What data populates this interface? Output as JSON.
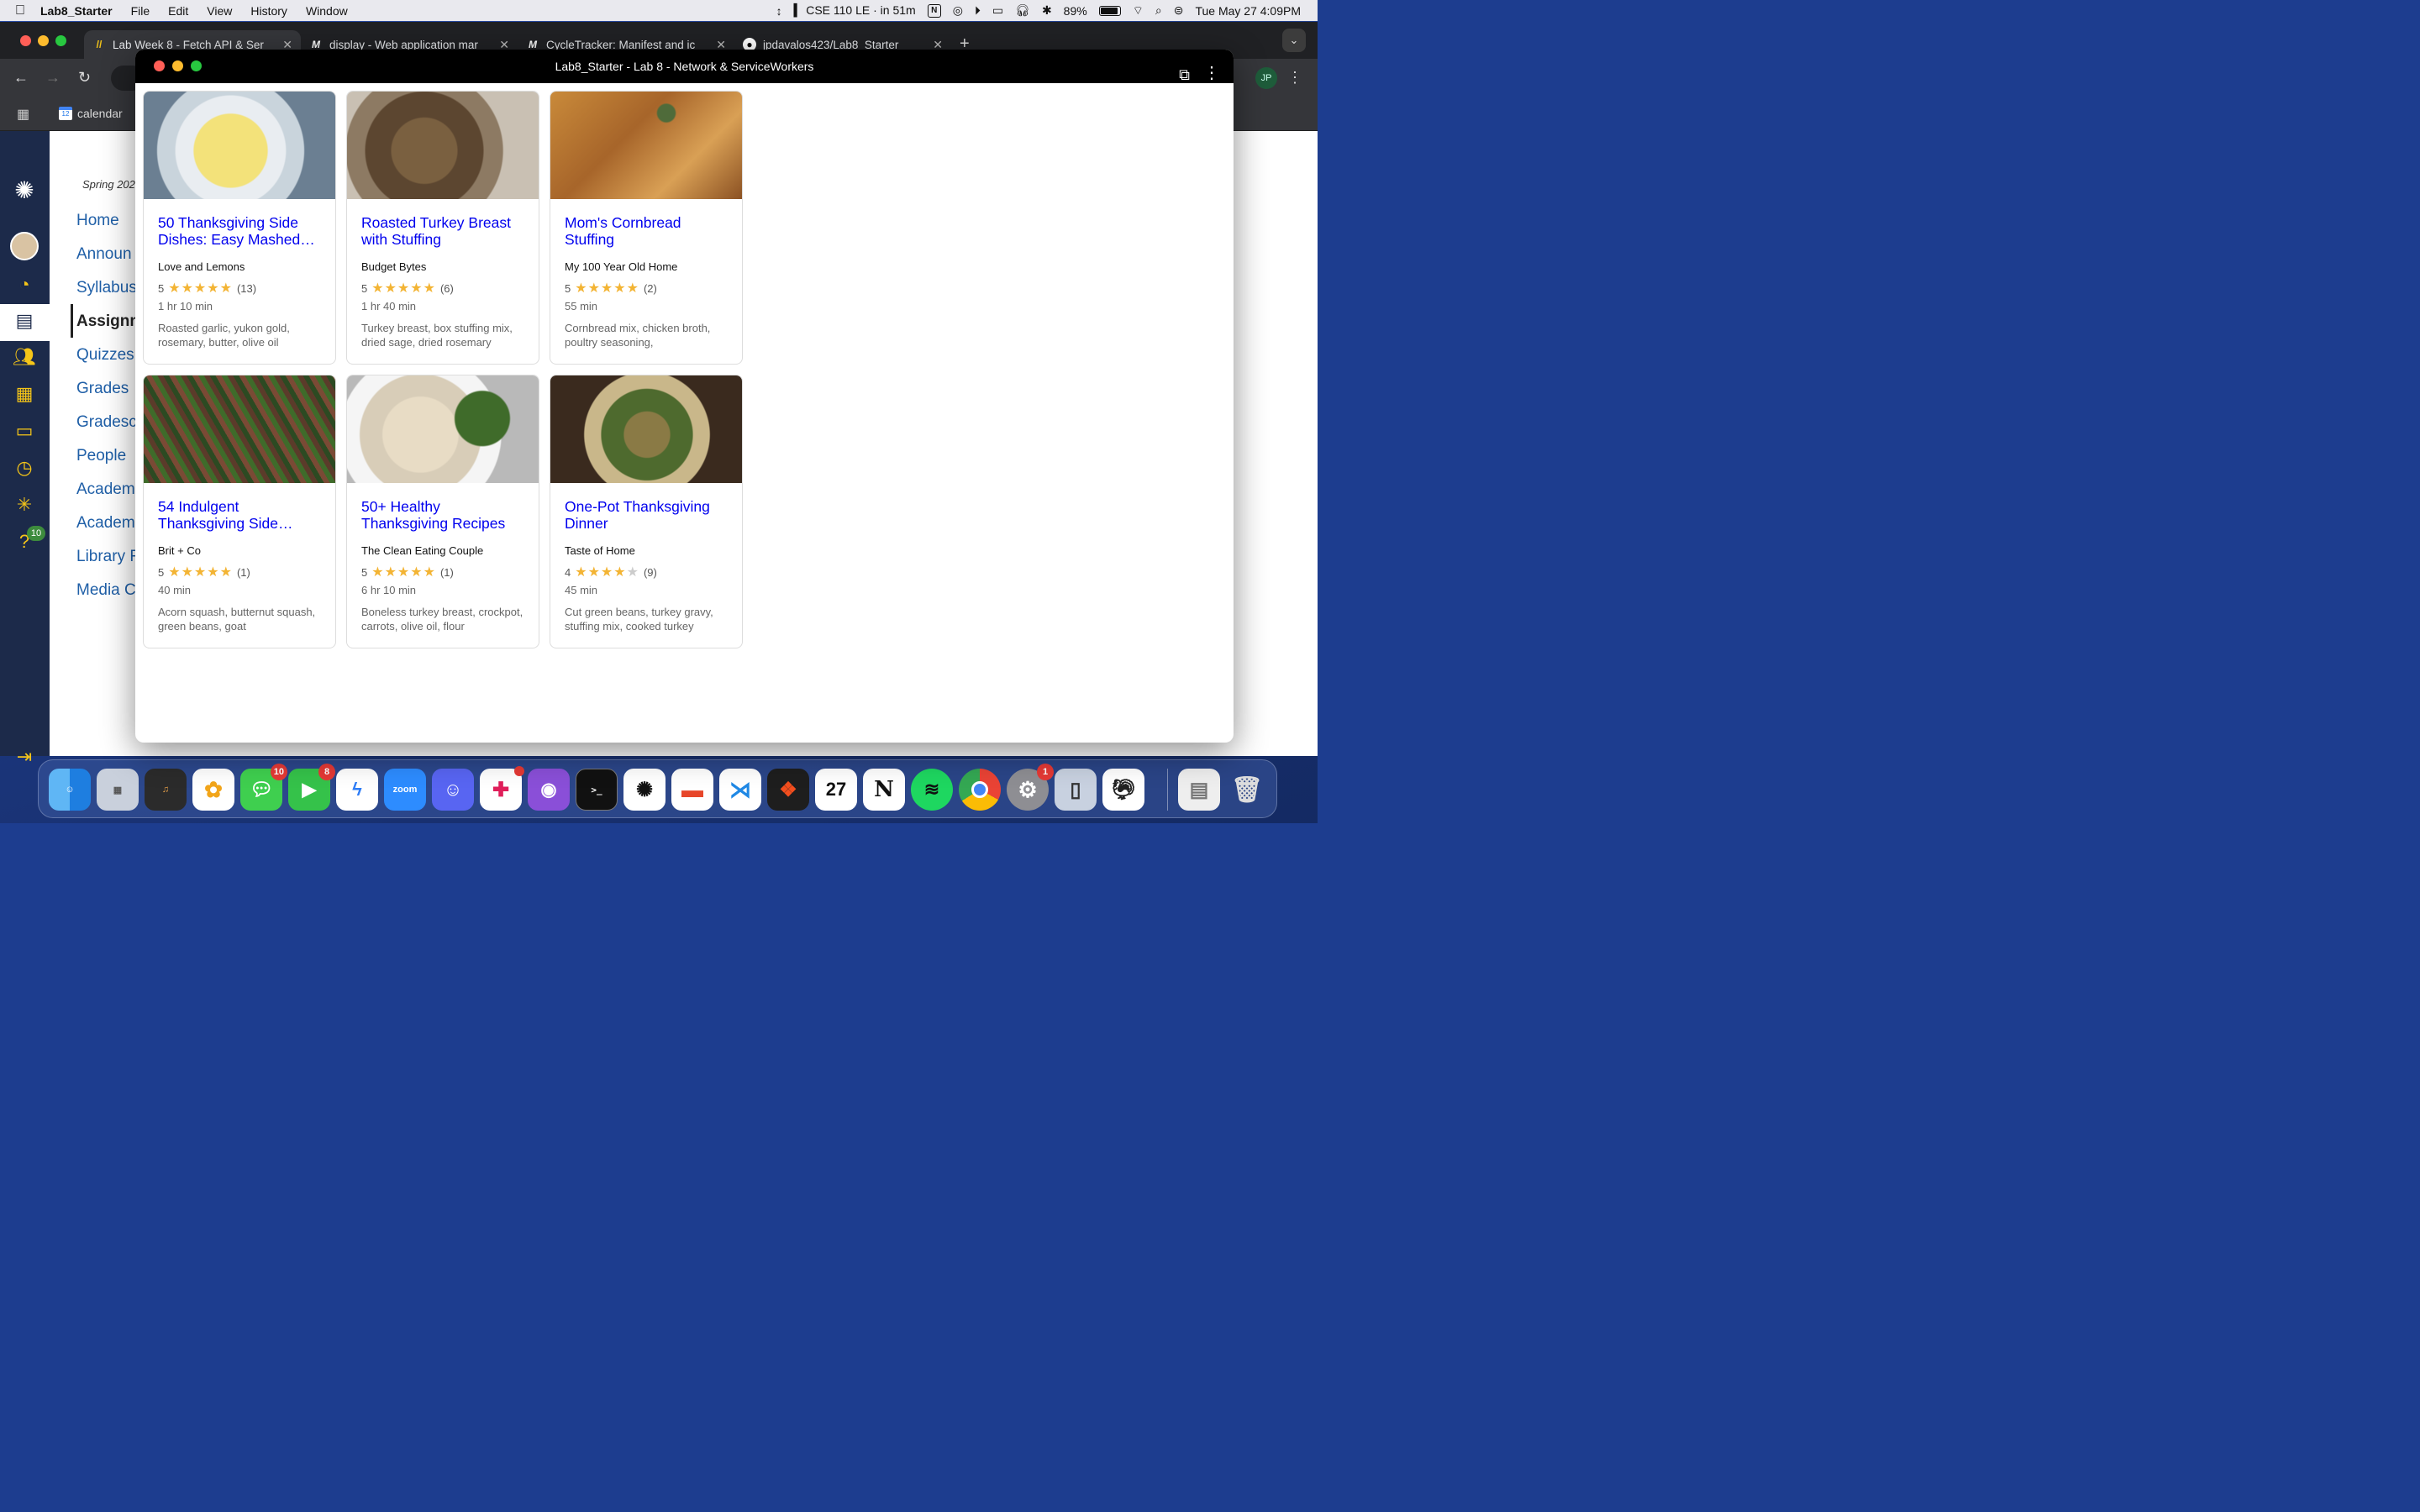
{
  "menubar": {
    "app": "Lab8_Starter",
    "items": [
      "File",
      "Edit",
      "View",
      "History",
      "Window"
    ],
    "status": "CSE 110 LE · in 51m",
    "battery": "89%",
    "datetime": "Tue May 27  4:09PM"
  },
  "chrome": {
    "tabs": [
      {
        "title": "Lab Week 8 - Fetch API & Ser",
        "icon": "slashes-icon"
      },
      {
        "title": "display - Web application mar",
        "icon": "mdn-icon"
      },
      {
        "title": "CycleTracker: Manifest and ic",
        "icon": "mdn-icon"
      },
      {
        "title": "jpdavalos423/Lab8_Starter",
        "icon": "github-icon"
      }
    ],
    "bookmark": "calendar",
    "profile": "JP"
  },
  "canvas": {
    "term": "Spring 202",
    "nav": [
      "Home",
      "Announ",
      "Syllabus",
      "Assignm",
      "Quizzes",
      "Grades",
      "Gradesc",
      "People",
      "Academ",
      "Academ",
      "Library F",
      "Media C"
    ],
    "help_badge": "10"
  },
  "window": {
    "title": "Lab8_Starter - Lab 8 - Network & ServiceWorkers"
  },
  "recipes": [
    {
      "title": "50 Thanksgiving Side Dishes: Easy Mashed…",
      "org": "Love and Lemons",
      "rating": "5",
      "stars": 5,
      "count": "(13)",
      "time": "1 hr 10 min",
      "ingredients": "Roasted garlic, yukon gold, rosemary, butter, olive oil",
      "img": "mashed-potatoes"
    },
    {
      "title": "Roasted Turkey Breast with Stuffing",
      "org": "Budget Bytes",
      "rating": "5",
      "stars": 5,
      "count": "(6)",
      "time": "1 hr 40 min",
      "ingredients": "Turkey breast, box stuffing mix, dried sage, dried rosemary",
      "img": "turkey-stuffing"
    },
    {
      "title": "Mom's Cornbread Stuffing",
      "org": "My 100 Year Old Home",
      "rating": "5",
      "stars": 5,
      "count": "(2)",
      "time": "55 min",
      "ingredients": "Cornbread mix, chicken broth, poultry seasoning,",
      "img": "cornbread-stuffing"
    },
    {
      "title": "54 Indulgent Thanksgiving Side…",
      "org": "Brit + Co",
      "rating": "5",
      "stars": 5,
      "count": "(1)",
      "time": "40 min",
      "ingredients": "Acorn squash, butternut squash, green beans, goat",
      "img": "green-beans-pecans"
    },
    {
      "title": "50+ Healthy Thanksgiving Recipes",
      "org": "The Clean Eating Couple",
      "rating": "5",
      "stars": 5,
      "count": "(1)",
      "time": "6 hr 10 min",
      "ingredients": "Boneless turkey breast, crockpot, carrots, olive oil, flour",
      "img": "turkey-plate"
    },
    {
      "title": "One-Pot Thanksgiving Dinner",
      "org": "Taste of Home",
      "rating": "4",
      "stars": 4,
      "count": "(9)",
      "time": "45 min",
      "ingredients": "Cut green beans, turkey gravy, stuffing mix, cooked turkey",
      "img": "one-pot-dinner"
    }
  ],
  "dock": {
    "apps": [
      "Finder",
      "Launchpad",
      "GarageBand",
      "Photos",
      "Messages",
      "FaceTime",
      "Messenger",
      "Zoom",
      "Discord",
      "Slack",
      "GitHub Desktop",
      "Terminal",
      "ChatGPT",
      "Slides",
      "VS Code",
      "Figma",
      "Calendar",
      "Notion",
      "Spotify",
      "Chrome",
      "System Settings",
      "iPhone Mirroring",
      "Turkey",
      "Preview",
      "Trash"
    ],
    "messages_badge": "10",
    "facetime_badge": "8",
    "settings_badge": "1",
    "calendar_day": "27",
    "zoom_label": "zoom"
  }
}
